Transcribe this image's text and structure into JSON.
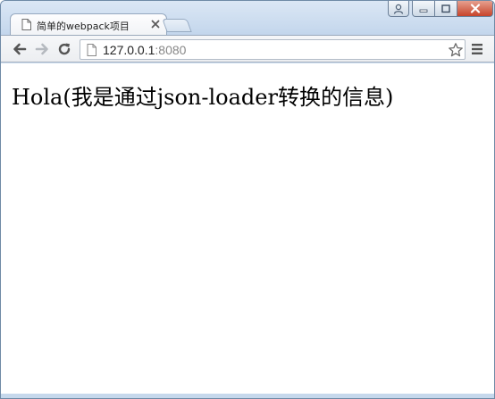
{
  "browser": {
    "tab": {
      "title": "简单的webpack项目"
    },
    "address_bar": {
      "host": "127.0.0.1",
      "port": ":8080"
    },
    "icons": {
      "tab_page": "document-icon",
      "tab_close": "close-icon",
      "back": "arrow-left-icon",
      "forward": "arrow-right-icon",
      "reload": "reload-icon",
      "address_page": "document-icon",
      "bookmark": "star-icon",
      "menu": "hamburger-menu-icon",
      "profile": "user-icon",
      "minimize": "minimize-icon",
      "maximize": "maximize-icon",
      "close_window": "close-icon"
    },
    "colors": {
      "close_button": "#c7442a",
      "frame": "#c6d8ec"
    }
  },
  "page": {
    "text": "Hola(我是通过json-loader转换的信息)"
  }
}
